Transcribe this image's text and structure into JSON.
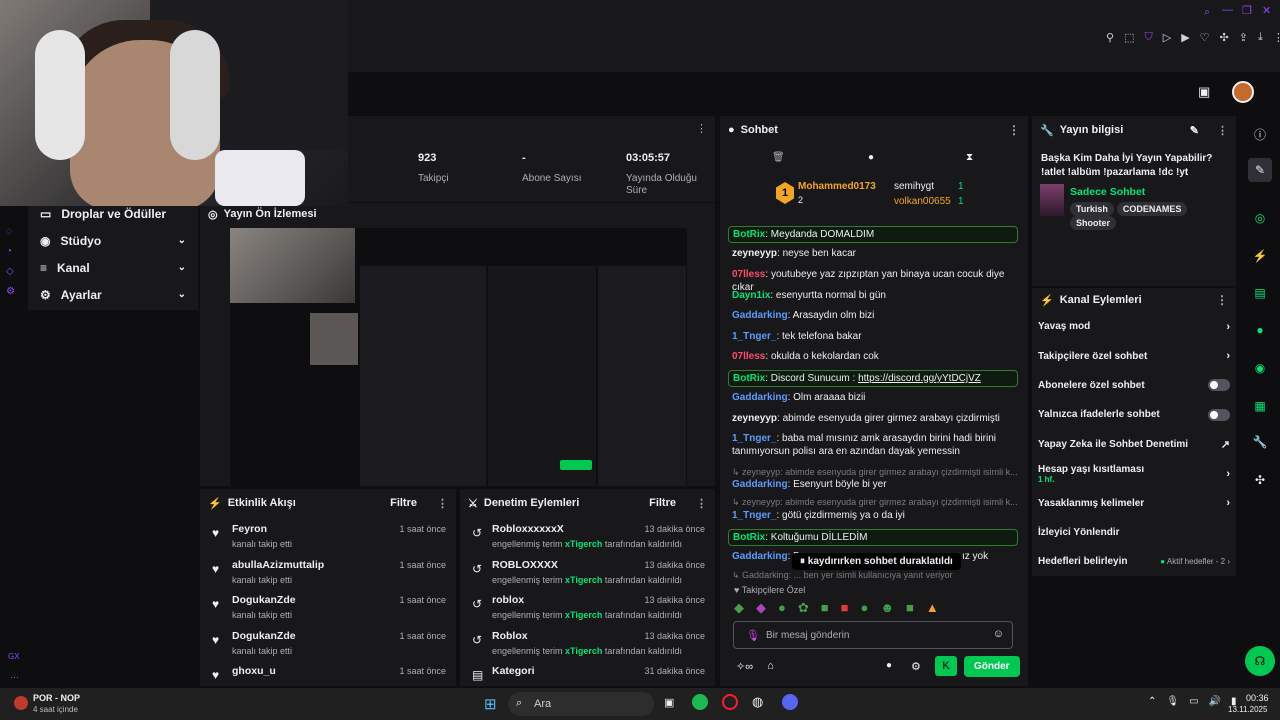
{
  "stats": [
    {
      "value": "923",
      "label": "Takipçi"
    },
    {
      "value": "-",
      "label": "Abone Sayısı"
    },
    {
      "value": "03:05:57",
      "label": "Yayında Olduğu Süre"
    }
  ],
  "left_nav": {
    "drops": "Droplar ve Ödüller",
    "items": [
      "Stüdyo",
      "Kanal",
      "Ayarlar"
    ]
  },
  "preview": {
    "title": "Yayın Ön İzlemesi"
  },
  "activity": {
    "title": "Etkinlik Akışı",
    "filter": "Filtre",
    "rows": [
      {
        "name": "Feyron",
        "sub": "kanalı takip etti",
        "time": "1 saat önce"
      },
      {
        "name": "abullaAzizmuttalip",
        "sub": "kanalı takip etti",
        "time": "1 saat önce"
      },
      {
        "name": "DogukanZde",
        "sub": "kanalı takip etti",
        "time": "1 saat önce"
      },
      {
        "name": "DogukanZde",
        "sub": "kanalı takip etti",
        "time": "1 saat önce"
      },
      {
        "name": "ghoxu_u",
        "sub": "",
        "time": "1 saat önce"
      }
    ]
  },
  "mod": {
    "title": "Denetim Eylemleri",
    "filter": "Filtre",
    "rows": [
      {
        "name": "RobloxxxxxxX",
        "pre": "engellenmiş terim",
        "user": "xTigerch",
        "post": "tarafından kaldırıldı",
        "time": "13 dakika önce"
      },
      {
        "name": "ROBLOXXXX",
        "pre": "engellenmiş terim",
        "user": "xTigerch",
        "post": "tarafından kaldırıldı",
        "time": "13 dakika önce"
      },
      {
        "name": "roblox",
        "pre": "engellenmiş terim",
        "user": "xTigerch",
        "post": "tarafından kaldırıldı",
        "time": "13 dakika önce"
      },
      {
        "name": "Roblox",
        "pre": "engellenmiş terim",
        "user": "xTigerch",
        "post": "tarafından kaldırıldı",
        "time": "13 dakika önce"
      },
      {
        "name": "Kategori",
        "pre": "",
        "user": "",
        "post": "",
        "time": "31 dakika önce"
      }
    ]
  },
  "chat": {
    "title": "Sohbet",
    "leaders": {
      "first": "Mohammed0173",
      "first_count": "2",
      "second": "semihygt",
      "second_count": "1",
      "third": "volkan00655",
      "third_count": "1",
      "rank": "1"
    },
    "messages": [
      {
        "user": "BotRix",
        "color": "#00e676",
        "text": "Meydanda DOMALDIM",
        "bot": true
      },
      {
        "user": "zeyneyyp",
        "color": "#efeff1",
        "text": "neyse ben kacar"
      },
      {
        "user": "07lless",
        "color": "#ff4a6a",
        "text": "youtubeye yaz zıpzıptan yan binaya ucan cocuk diye cıkar"
      },
      {
        "user": "Dayn1ix",
        "color": "#00e676",
        "text": "esenyurtta normal bi gün"
      },
      {
        "user": "Gaddarking",
        "color": "#5b9cff",
        "text": "Arasaydın olm bizi"
      },
      {
        "user": "1_Tnger_",
        "color": "#5b9cff",
        "text": "tek telefona bakar"
      },
      {
        "user": "07lless",
        "color": "#ff4a6a",
        "text": "okulda o kekolardan cok"
      },
      {
        "user": "BotRix",
        "color": "#00e676",
        "text": "Discord Sunucum :",
        "link": "https://discord.gg/yYtDCjVZ",
        "bot": true
      },
      {
        "user": "Gaddarking",
        "color": "#5b9cff",
        "text": "Olm araaaa bizii"
      },
      {
        "user": "zeyneyyp",
        "color": "#efeff1",
        "text": "abimde esenyuda girer girmez arabayı çizdirmişti"
      },
      {
        "user": "1_Tnger_",
        "color": "#5b9cff",
        "text": "baba mal mısınız amk arasaydın birini hadi birini tanımıyorsun polisı ara en azından dayak yemessin"
      },
      {
        "reply": "zeyneyyp: abimde esenyuda girer girmez arabayı çizdirmişti isimli k..."
      },
      {
        "user": "Gaddarking",
        "color": "#5b9cff",
        "text": "Esenyurt böyle bi yer"
      },
      {
        "reply": "zeyneyyp: abimde esenyuda girer girmez arabayı çizdirmişti isimli k..."
      },
      {
        "user": "1_Tnger_",
        "color": "#5b9cff",
        "text": "götü çizdirmemiş ya o da iyi"
      },
      {
        "user": "BotRix",
        "color": "#00e676",
        "text": "Koltuğumu DİLLEDİM",
        "bot": true
      },
      {
        "user": "Gaddarking",
        "color": "#5b9cff",
        "text": "D",
        "tail": "ız yok"
      },
      {
        "reply": "Gaddarking: ... ben yer isimli kullanıcıya yanıt veriyor"
      }
    ],
    "paused": "kaydırırken sohbet duraklatıldı",
    "followers_only": "Takipçilere Özel",
    "placeholder": "Bir mesaj gönderin",
    "send": "Gönder"
  },
  "info": {
    "title": "Yayın bilgisi",
    "stream_title": "Başka Kim Daha İyi Yayın Yapabilir? !atlet !albüm !pazarlama !dc !yt",
    "category": "Sadece Sohbet",
    "tags": [
      "Turkish",
      "CODENAMES",
      "Shooter"
    ]
  },
  "actions": {
    "title": "Kanal Eylemleri",
    "items": [
      "Yavaş mod",
      "Takipçilere özel sohbet",
      "Abonelere özel sohbet",
      "Yalnızca ifadelerle sohbet",
      "Yapay Zeka ile Sohbet Denetimi",
      "Hesap yaşı kısıtlaması",
      "Yasaklanmış kelimeler",
      "İzleyici Yönlendir",
      "Hedefleri belirleyin"
    ],
    "age_value": "1 hf.",
    "goal_value": "Aktif hedefler - 2"
  },
  "taskbar": {
    "stream_title": "POR - NOP",
    "stream_sub": "4 saat içinde",
    "search": "Ara",
    "time": "00:36",
    "date": "13.11.2025"
  }
}
